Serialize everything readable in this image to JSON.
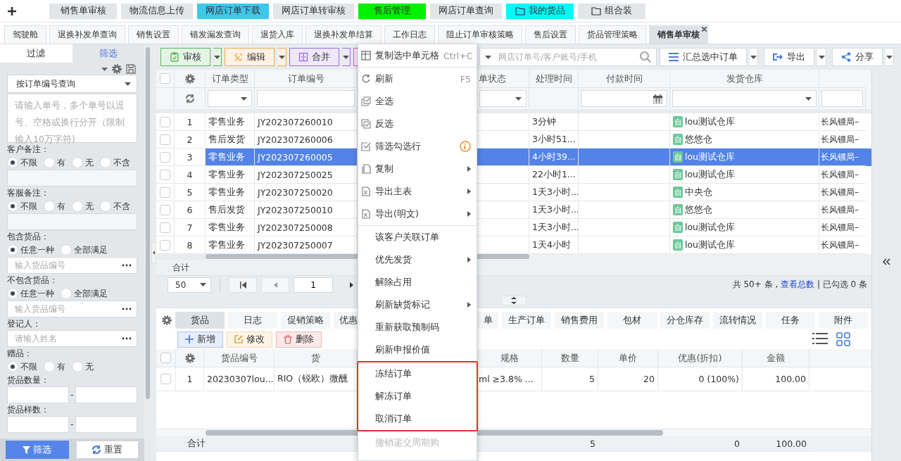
{
  "top_tabs": [
    {
      "label": "销售单审核",
      "kind": "page",
      "color": "#e3e6e9"
    },
    {
      "label": "物流信息上传",
      "kind": "page",
      "color": "#e3e6e9"
    },
    {
      "label": "网店订单下载",
      "kind": "page",
      "color": "#3fc7ea"
    },
    {
      "label": "网店订单转审核",
      "kind": "page",
      "color": "#e3e6e9"
    },
    {
      "label": "售后管理",
      "kind": "page",
      "color": "#00f000"
    },
    {
      "label": "网店订单查询",
      "kind": "page",
      "color": "#e3e6e9"
    },
    {
      "label": "我的货品",
      "kind": "folder",
      "color": "#00fafa"
    },
    {
      "label": "组合装",
      "kind": "folder",
      "color": "#e3e6e9"
    }
  ],
  "open_tabs": [
    {
      "label": "驾驶舱",
      "selected": false
    },
    {
      "label": "退换补发单查询",
      "selected": false
    },
    {
      "label": "销售设置",
      "selected": false
    },
    {
      "label": "错发漏发查询",
      "selected": false
    },
    {
      "label": "退货入库",
      "selected": false
    },
    {
      "label": "退换补发单结算",
      "selected": false
    },
    {
      "label": "工作日志",
      "selected": false
    },
    {
      "label": "阻止订单审核策略",
      "selected": false
    },
    {
      "label": "售后设置",
      "selected": false
    },
    {
      "label": "货品管理策略",
      "selected": false
    },
    {
      "label": "销售单审核",
      "selected": true
    }
  ],
  "sidebar": {
    "tabs": [
      {
        "label": "过滤",
        "selected": false
      },
      {
        "label": "筛选",
        "selected": true
      }
    ],
    "query_select": "按订单编号查询",
    "order_input": {
      "placeholder": "请输入单号，多个单号以逗号、空格或换行分开（限制输入10万字符)"
    },
    "sections": [
      {
        "label": "客户备注：",
        "kind": "radio-field",
        "options": [
          {
            "label": "不限",
            "selected": true
          },
          {
            "label": "有",
            "selected": false
          },
          {
            "label": "无",
            "selected": false
          },
          {
            "label": "不含",
            "selected": false
          }
        ],
        "field": {
          "lookup": false
        }
      },
      {
        "label": "客服备注：",
        "kind": "radio-field",
        "options": [
          {
            "label": "不限",
            "selected": true
          },
          {
            "label": "有",
            "selected": false
          },
          {
            "label": "无",
            "selected": false
          },
          {
            "label": "不含",
            "selected": false
          }
        ],
        "field": {
          "lookup": false
        }
      },
      {
        "label": "包含货品：",
        "kind": "radio-field",
        "options": [
          {
            "label": "任意一种",
            "selected": true
          },
          {
            "label": "全部满足",
            "selected": false
          }
        ],
        "field": {
          "placeholder": "输入货品编号",
          "lookup": true
        }
      },
      {
        "label": "不包含货品：",
        "kind": "radio-field",
        "options": [
          {
            "label": "任意一种",
            "selected": true
          },
          {
            "label": "全部满足",
            "selected": false
          }
        ],
        "field": {
          "placeholder": "输入货品编号",
          "lookup": true
        }
      },
      {
        "label": "登记人：",
        "kind": "field",
        "field": {
          "placeholder": "请输入姓名",
          "lookup": true
        }
      },
      {
        "label": "赠品：",
        "kind": "radio",
        "options": [
          {
            "label": "不限",
            "selected": true
          },
          {
            "label": "有",
            "selected": false
          },
          {
            "label": "无",
            "selected": false
          }
        ]
      },
      {
        "label": "货品数量：",
        "kind": "range",
        "separator": "-"
      },
      {
        "label": "货品样数：",
        "kind": "range",
        "separator": "-"
      }
    ],
    "buttons": [
      {
        "label": "筛选",
        "kind": "primary"
      },
      {
        "label": "重置",
        "kind": "reset"
      }
    ]
  },
  "toolbar": {
    "buttons": [
      {
        "label": "审核",
        "kind": "audit",
        "color": "#5cb85c"
      },
      {
        "label": "编辑",
        "kind": "edit",
        "color": "#f0ad4e"
      },
      {
        "label": "合并",
        "kind": "merge",
        "color": "#9b6ee6"
      },
      {
        "kind": "split",
        "color": "#d65cc0"
      }
    ],
    "search": {
      "placeholder": "网店订单号/客户账号/手机"
    },
    "actions": [
      {
        "label": "汇总选中订单",
        "kind": "summary"
      },
      {
        "label": "导出",
        "kind": "export"
      },
      {
        "label": "分享",
        "kind": "share"
      }
    ]
  },
  "orders": {
    "all_checked": false,
    "columns": [
      {
        "label": "订单类型",
        "kind": "select"
      },
      {
        "label": "订单编号",
        "kind": "text"
      },
      {
        "label": "单状态",
        "kind": "select"
      },
      {
        "label": "处理时间",
        "kind": "none"
      },
      {
        "label": "付款时间",
        "kind": "date"
      },
      {
        "label": "发货仓库",
        "kind": "select"
      },
      {
        "kind": "text"
      }
    ],
    "rows": [
      {
        "no": "1",
        "type": "零售业务",
        "order_no": "JY202307260010",
        "elapsed": "3分钟",
        "warehouse_tag": "自",
        "warehouse": "lou测试仓库",
        "column_9": "长风镖局–",
        "selected": false,
        "checked": false
      },
      {
        "no": "2",
        "type": "售后发货",
        "order_no": "JY202307260006",
        "elapsed": "3小时51...",
        "warehouse_tag": "自",
        "warehouse": "悠悠仓",
        "column_9": "长风镖局–",
        "selected": false,
        "checked": false
      },
      {
        "no": "3",
        "type": "零售业务",
        "order_no": "JY202307260005",
        "elapsed": "4小时39...",
        "warehouse_tag": "自",
        "warehouse": "lou测试仓库",
        "column_9": "长风镖局–",
        "selected": true,
        "checked": false
      },
      {
        "no": "4",
        "type": "零售业务",
        "order_no": "JY202307250025",
        "elapsed": "22小时1...",
        "warehouse_tag": "自",
        "warehouse": "lou测试仓库",
        "column_9": "长风镖局–",
        "selected": false,
        "checked": false
      },
      {
        "no": "5",
        "type": "零售业务",
        "order_no": "JY202307250020",
        "elapsed": "1天3小时...",
        "warehouse_tag": "自",
        "warehouse": "中央仓",
        "column_9": "长风镖局–",
        "selected": false,
        "checked": false
      },
      {
        "no": "6",
        "type": "售后发货",
        "order_no": "JY202307250010",
        "elapsed": "1天3小时...",
        "warehouse_tag": "自",
        "warehouse": "悠悠仓",
        "column_9": "长风镖局–",
        "selected": false,
        "checked": false
      },
      {
        "no": "7",
        "type": "零售业务",
        "order_no": "JY202307250008",
        "elapsed": "1天3小时...",
        "warehouse_tag": "自",
        "warehouse": "lou测试仓库",
        "column_9": "长风镖局–",
        "selected": false,
        "checked": false
      },
      {
        "no": "8",
        "type": "零售业务",
        "order_no": "JY202307250007",
        "elapsed": "1天4小时",
        "warehouse_tag": "自",
        "warehouse": "lou测试仓库",
        "column_9": "长风镖局–",
        "selected": false,
        "checked": false
      }
    ],
    "total_label": "合计",
    "pager": {
      "page_size": "50",
      "page": "1",
      "summary_before": "共 50+ 条 , ",
      "summary_link": "查看总数",
      "summary_after": " | 已勾选 0 条"
    }
  },
  "detail": {
    "tabs": [
      {
        "label": "货品",
        "selected": true
      },
      {
        "label": "日志",
        "selected": false
      },
      {
        "label": "促销策略",
        "selected": false
      },
      {
        "label": "优惠",
        "selected": false
      },
      {
        "label": "单",
        "selected": false
      },
      {
        "label": "生产订单",
        "selected": false
      },
      {
        "label": "销售费用",
        "selected": false
      },
      {
        "label": "包材",
        "selected": false
      },
      {
        "label": "分仓库存",
        "selected": false
      },
      {
        "label": "流转情况",
        "selected": false
      },
      {
        "label": "任务",
        "selected": false
      },
      {
        "label": "附件",
        "selected": false
      }
    ],
    "buttons": [
      {
        "label": "新增",
        "kind": "add"
      },
      {
        "label": "修改",
        "kind": "edit"
      },
      {
        "label": "删除",
        "kind": "delete"
      }
    ],
    "all_checked": false,
    "columns": [
      "货品编号",
      "货",
      "规格",
      "数量",
      "单价",
      "优惠(折扣)",
      "金额"
    ],
    "rows": [
      {
        "no": "1",
        "checked": false,
        "cells": [
          "20230307lou...",
          "RIO（锐欧）微醺",
          "ml ≥3.8% ...",
          "5",
          "20",
          "0 (100%)",
          "100.00"
        ]
      }
    ],
    "totals": {
      "label": "合计",
      "quantity": "5",
      "discount": "0",
      "amount": "100.00"
    }
  },
  "context_menu": {
    "groups": [
      {
        "divided": false,
        "highlighted": false,
        "items": [
          {
            "label": "复制选中单元格",
            "kind": "copy-cells",
            "shortcut": "Ctrl+C",
            "submenu": false,
            "disabled": false
          }
        ]
      },
      {
        "divided": true,
        "highlighted": false,
        "items": [
          {
            "label": "刷新",
            "kind": "refresh",
            "shortcut": "F5",
            "submenu": false,
            "disabled": false
          },
          {
            "label": "全选",
            "kind": "select-all",
            "submenu": false,
            "disabled": false
          },
          {
            "label": "反选",
            "kind": "invert",
            "submenu": false,
            "disabled": false
          },
          {
            "label": "筛选勾选行",
            "kind": "filter-checked",
            "submenu": false,
            "disabled": false
          },
          {
            "label": "复制",
            "kind": "copy",
            "submenu": true,
            "disabled": false
          },
          {
            "label": "导出主表",
            "kind": "export",
            "submenu": true,
            "disabled": false
          },
          {
            "label": "导出(明文)",
            "kind": "export",
            "submenu": true,
            "disabled": false
          }
        ]
      },
      {
        "divided": true,
        "highlighted": false,
        "items": [
          {
            "label": "该客户关联订单",
            "kind": "plain",
            "submenu": false,
            "disabled": false
          },
          {
            "label": "优先发货",
            "kind": "plain",
            "submenu": true,
            "disabled": false
          },
          {
            "label": "解除占用",
            "kind": "plain",
            "submenu": false,
            "disabled": false
          },
          {
            "label": "刷新缺货标记",
            "kind": "plain",
            "submenu": true,
            "disabled": false
          },
          {
            "label": "重新获取预制码",
            "kind": "plain",
            "submenu": false,
            "disabled": false
          },
          {
            "label": "刷新申报价值",
            "kind": "plain",
            "submenu": false,
            "disabled": false
          }
        ]
      },
      {
        "divided": false,
        "highlighted": true,
        "items": [
          {
            "label": "冻结订单",
            "kind": "plain",
            "submenu": false,
            "disabled": false
          },
          {
            "label": "解冻订单",
            "kind": "plain",
            "submenu": false,
            "disabled": false
          },
          {
            "label": "取消订单",
            "kind": "plain",
            "submenu": false,
            "disabled": false
          }
        ]
      },
      {
        "divided": false,
        "highlighted": false,
        "items": [
          {
            "label": "撤销递交周期购",
            "kind": "plain",
            "submenu": false,
            "disabled": true
          }
        ]
      }
    ]
  }
}
